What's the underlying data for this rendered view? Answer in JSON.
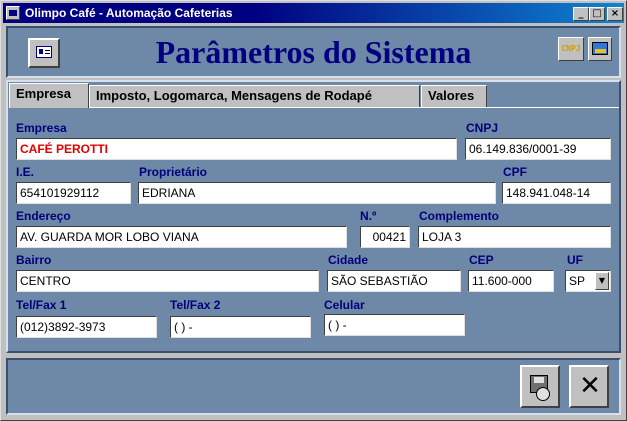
{
  "window": {
    "title": "Olimpo Café - Automação Cafeterias",
    "minimize": "_",
    "maximize": "□",
    "close": "×"
  },
  "header": {
    "title": "Parâmetros do Sistema",
    "cnpj_icon_label": "CNPJ"
  },
  "tabs": [
    {
      "label": "Empresa"
    },
    {
      "label": "Imposto, Logomarca, Mensagens de Rodapé"
    },
    {
      "label": "Valores"
    }
  ],
  "form": {
    "empresa": {
      "label": "Empresa",
      "value": "CAFÉ PEROTTI"
    },
    "cnpj": {
      "label": "CNPJ",
      "value": "06.149.836/0001-39"
    },
    "ie": {
      "label": "I.E.",
      "value": "654101929112"
    },
    "proprietario": {
      "label": "Proprietário",
      "value": "EDRIANA"
    },
    "cpf": {
      "label": "CPF",
      "value": "148.941.048-14"
    },
    "endereco": {
      "label": "Endereço",
      "value": "AV. GUARDA MOR LOBO VIANA"
    },
    "numero": {
      "label": "N.º",
      "value": "00421"
    },
    "complemento": {
      "label": "Complemento",
      "value": "LOJA 3"
    },
    "bairro": {
      "label": "Bairro",
      "value": "CENTRO"
    },
    "cidade": {
      "label": "Cidade",
      "value": "SÃO SEBASTIÃO"
    },
    "cep": {
      "label": "CEP",
      "value": "11.600-000"
    },
    "uf": {
      "label": "UF",
      "value": "SP"
    },
    "telfax1": {
      "label": "Tel/Fax 1",
      "value": "(012)3892-3973"
    },
    "telfax2": {
      "label": "Tel/Fax 2",
      "value": "(  )     -"
    },
    "celular": {
      "label": "Celular",
      "value": "(  )     -"
    }
  },
  "footer": {
    "close_glyph": "✕"
  },
  "icons": {
    "app": "app-icon",
    "card": "id-card-icon",
    "cnpj": "cnpj-icon",
    "image": "image-icon",
    "save": "save-disk-icon",
    "exit": "exit-icon"
  },
  "colors": {
    "panel_bg": "#6e88a8",
    "title_text": "#000080",
    "label_text": "#00007a",
    "empresa_value": "#e00000"
  }
}
